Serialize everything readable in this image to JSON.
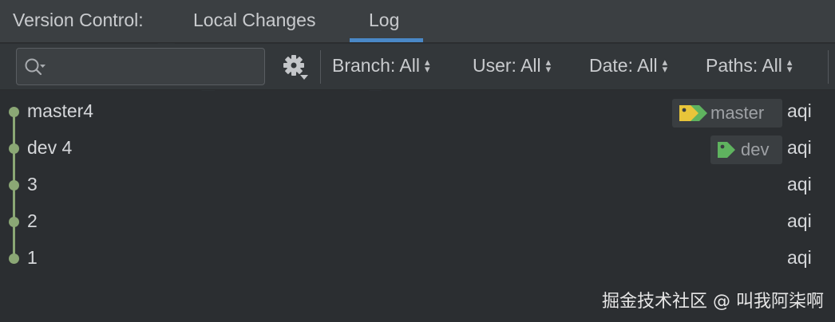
{
  "tabbar": {
    "label": "Version Control:",
    "tabs": [
      {
        "label": "Local Changes"
      },
      {
        "label": "Log",
        "active": true
      }
    ]
  },
  "toolbar": {
    "search": {
      "placeholder": "",
      "value": "",
      "icon": "search-icon"
    },
    "settings_icon": "gear-icon",
    "filters": [
      {
        "label": "Branch: All"
      },
      {
        "label": "User: All"
      },
      {
        "label": "Date: All"
      },
      {
        "label": "Paths: All"
      }
    ]
  },
  "commits": [
    {
      "message": "master4",
      "author": "aqi",
      "tags": [
        {
          "name": "master",
          "color": "#e8c53a",
          "secondary": "#5fb35f"
        }
      ]
    },
    {
      "message": "dev 4",
      "author": "aqi",
      "tags": [
        {
          "name": "dev",
          "color": "#5fb35f"
        }
      ]
    },
    {
      "message": "3",
      "author": "aqi",
      "tags": []
    },
    {
      "message": "2",
      "author": "aqi",
      "tags": []
    },
    {
      "message": "1",
      "author": "aqi",
      "tags": []
    }
  ],
  "watermark": "掘金技术社区 @ 叫我阿柒啊",
  "colors": {
    "graph": "#8ba775",
    "accent_underline": "#4a88c7",
    "background": "#2b2e31"
  }
}
